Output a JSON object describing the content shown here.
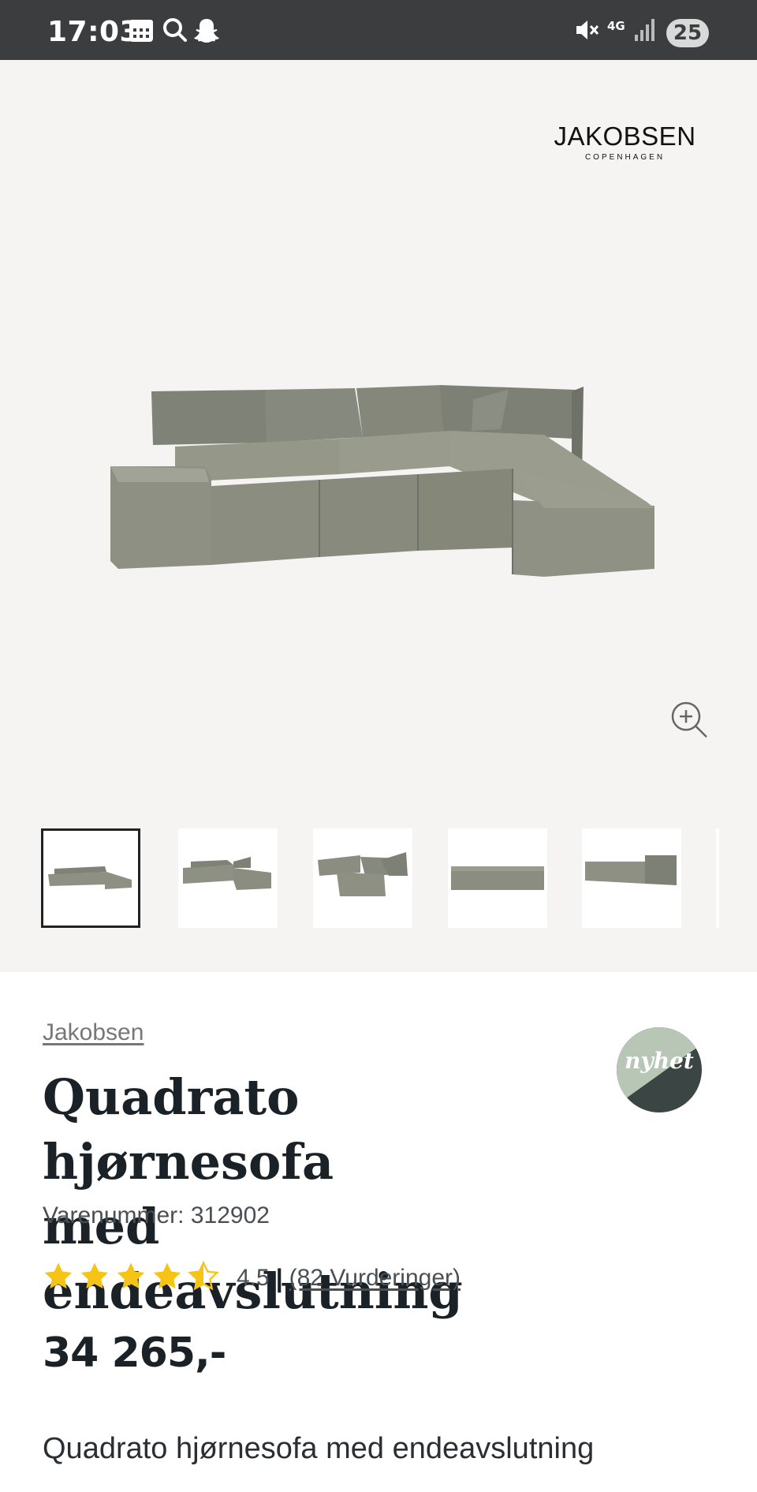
{
  "status_bar": {
    "time": "17:03",
    "network": "4G",
    "battery": "25",
    "icons": [
      "calendar-icon",
      "search-icon",
      "snapchat-icon",
      "mute-icon",
      "signal-icon"
    ]
  },
  "gallery": {
    "logo_main": "JAKOBSEN",
    "logo_sub": "COPENHAGEN",
    "zoom_icon": "zoom-in-icon",
    "thumbnails": [
      {
        "label": "corner sofa front view"
      },
      {
        "label": "corner sofa angled view"
      },
      {
        "label": "corner sofa side view"
      },
      {
        "label": "sofa straight view"
      },
      {
        "label": "sofa end view"
      }
    ],
    "background_color": "#f5f4f2",
    "sofa_color": "#8b8e82"
  },
  "product": {
    "brand": "Jakobsen",
    "badge": "nyhet",
    "title_line1": "Quadrato hjørnesofa",
    "title_line2": "med endeavslutning",
    "sku": "Varenummer: 312902",
    "rating_value": "4.5",
    "rating_separator": "|",
    "rating_count": "(82 Vurderinger)",
    "rating_stars": 4.5,
    "price": "34 265,-",
    "description": "Quadrato hjørnesofa med endeavslutning"
  },
  "colors": {
    "star": "#f6c414",
    "badge_light": "#b8c6b6",
    "badge_dark": "#3b4543"
  }
}
